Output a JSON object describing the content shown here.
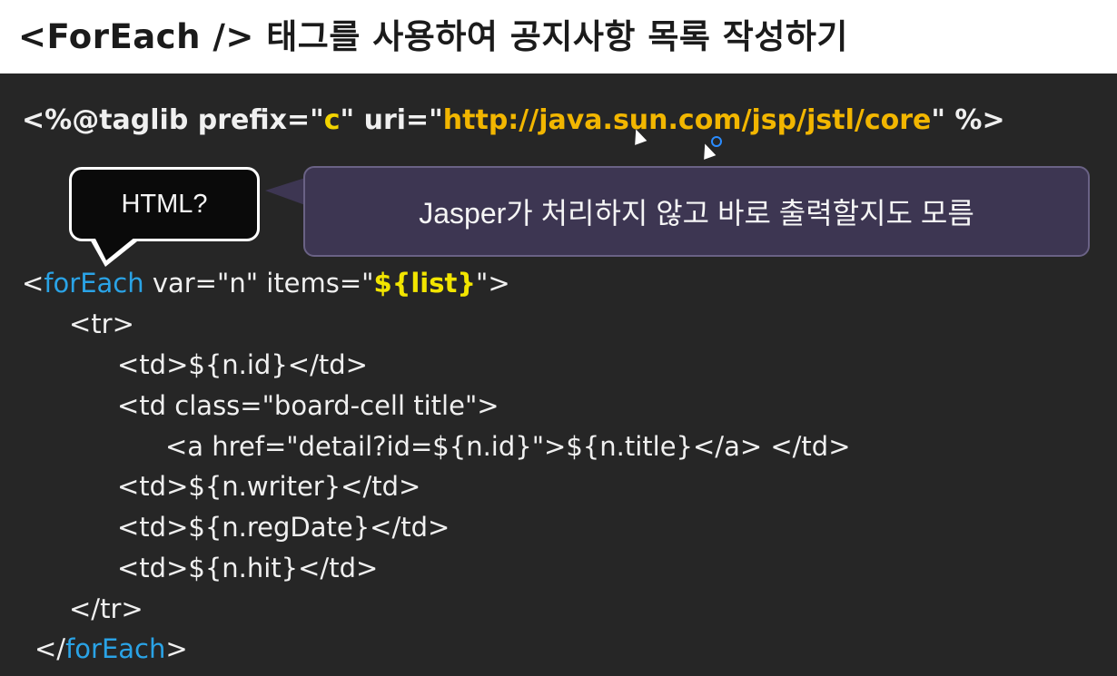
{
  "title": "<ForEach /> 태그를 사용하여 공지사항 목록 작성하기",
  "taglib": {
    "prefix_open": "<%@taglib prefix=\"",
    "prefix_value": "c",
    "uri_open": "\" uri=\"",
    "uri_value": "http://java.sun.com/jsp/jstl/core",
    "close": "\" %>"
  },
  "callouts": {
    "left": "HTML?",
    "right": "Jasper가 처리하지 않고 바로 출력할지도 모름"
  },
  "code": {
    "foreach_open_lt": "<",
    "foreach_tag": "forEach",
    "foreach_attrs": " var=\"n\" items=\"",
    "foreach_items": "${list}",
    "foreach_open_gt": "\">",
    "tr_open": "<tr>",
    "td_id": "<td>${n.id}</td>",
    "td_title_open": "<td class=\"board-cell title\">",
    "a_link": "<a href=\"detail?id=${n.id}\">${n.title}</a> </td>",
    "td_writer": "<td>${n.writer}</td>",
    "td_regdate": "<td>${n.regDate}</td>",
    "td_hit": "<td>${n.hit}</td>",
    "tr_close": "</tr>",
    "foreach_close_lt": "</",
    "foreach_close_gt": ">"
  }
}
